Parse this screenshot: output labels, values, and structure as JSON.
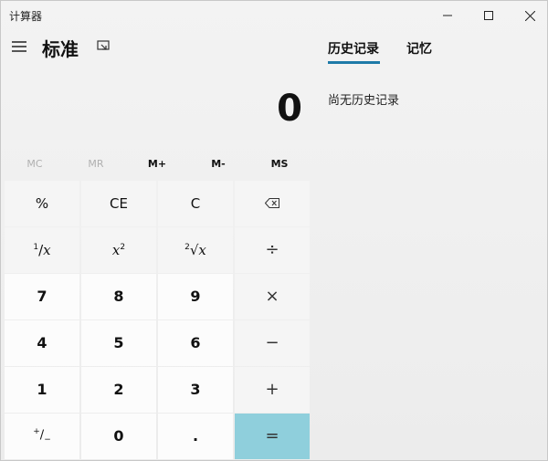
{
  "window": {
    "title": "计算器"
  },
  "header": {
    "mode": "标准"
  },
  "display": {
    "value": "0"
  },
  "memory": {
    "mc": "MC",
    "mr": "MR",
    "m_plus": "M+",
    "m_minus": "M-",
    "ms": "MS"
  },
  "keys": {
    "percent": "%",
    "ce": "CE",
    "c": "C",
    "seven": "7",
    "eight": "8",
    "nine": "9",
    "four": "4",
    "five": "5",
    "six": "6",
    "one": "1",
    "two": "2",
    "three": "3",
    "zero": "0",
    "decimal": ".",
    "divide": "÷",
    "multiply": "×",
    "minus": "−",
    "plus": "+",
    "equals": "="
  },
  "panel": {
    "tab_history": "历史记录",
    "tab_memory": "记忆",
    "history_empty": "尚无历史记录"
  },
  "colors": {
    "equals_bg": "#8fcfdc",
    "tab_underline": "#1e7aa8"
  }
}
